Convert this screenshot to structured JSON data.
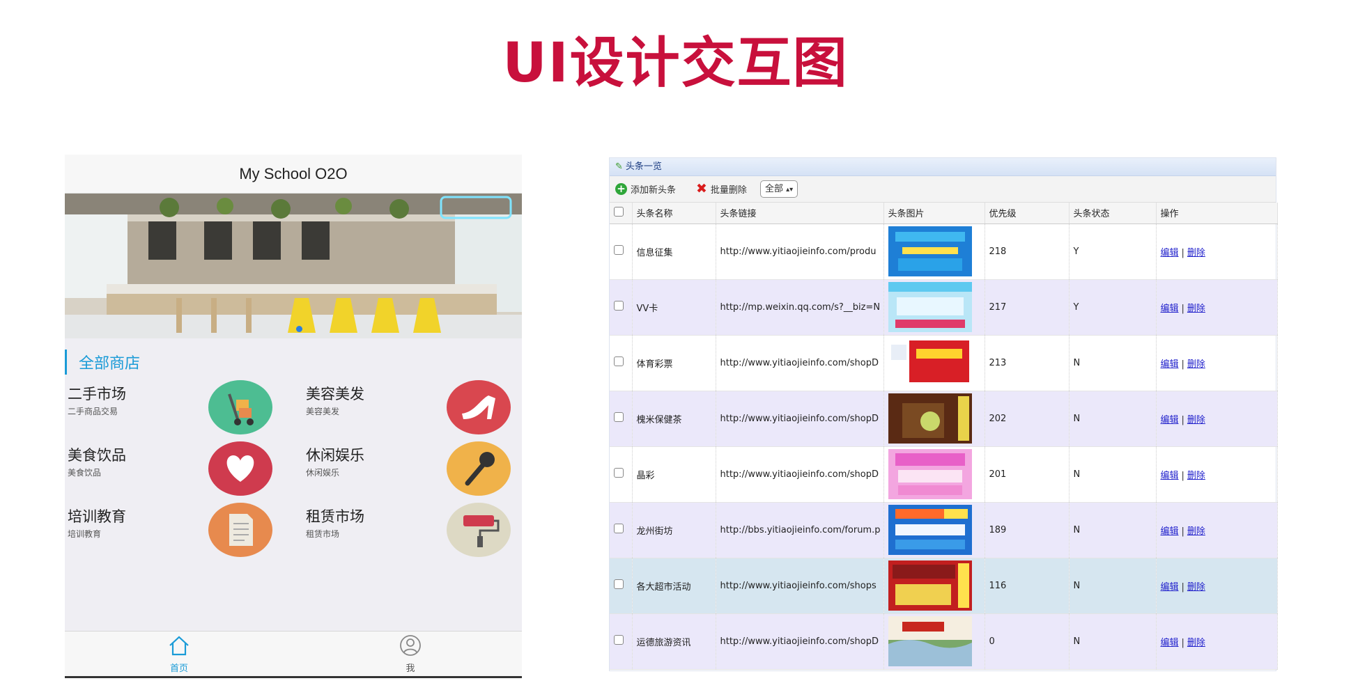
{
  "slide": {
    "title": "UI设计交互图"
  },
  "mobile": {
    "app_title": "My School O2O",
    "section_title": "全部商店",
    "categories": [
      {
        "name": "二手市场",
        "desc": "二手商品交易",
        "icon": "cart-icon",
        "color": "#4dbd92"
      },
      {
        "name": "美容美发",
        "desc": "美容美发",
        "icon": "high-heel-icon",
        "color": "#d9474f"
      },
      {
        "name": "美食饮品",
        "desc": "美食饮品",
        "icon": "heart-icon",
        "color": "#cf3b4e"
      },
      {
        "name": "休闲娱乐",
        "desc": "休闲娱乐",
        "icon": "microphone-icon",
        "color": "#f0b24a"
      },
      {
        "name": "培训教育",
        "desc": "培训教育",
        "icon": "document-icon",
        "color": "#e78a4e"
      },
      {
        "name": "租赁市场",
        "desc": "租赁市场",
        "icon": "paint-roller-icon",
        "color": "#ddd9c4"
      }
    ],
    "tabbar": [
      {
        "label": "首页",
        "icon": "home-icon",
        "active": true
      },
      {
        "label": "我",
        "icon": "user-icon",
        "active": false
      }
    ],
    "colors": {
      "accent": "#1a9bd7"
    }
  },
  "admin": {
    "panel_title": "头条一览",
    "toolbar": {
      "add_label": "添加新头条",
      "delete_label": "批量删除",
      "filter_value": "全部"
    },
    "columns": [
      "头条名称",
      "头条链接",
      "头条图片",
      "优先级",
      "头条状态",
      "操作"
    ],
    "rows": [
      {
        "name": "信息征集",
        "link": "http://www.yitiaojieinfo.com/produ",
        "priority": "218",
        "status": "Y",
        "edit": "编辑",
        "delete": "删除"
      },
      {
        "name": "VV卡",
        "link": "http://mp.weixin.qq.com/s?__biz=N",
        "priority": "217",
        "status": "Y",
        "edit": "编辑",
        "delete": "删除"
      },
      {
        "name": "体育彩票",
        "link": "http://www.yitiaojieinfo.com/shopD",
        "priority": "213",
        "status": "N",
        "edit": "编辑",
        "delete": "删除"
      },
      {
        "name": "槐米保健茶",
        "link": "http://www.yitiaojieinfo.com/shopD",
        "priority": "202",
        "status": "N",
        "edit": "编辑",
        "delete": "删除"
      },
      {
        "name": "晶彩",
        "link": "http://www.yitiaojieinfo.com/shopD",
        "priority": "201",
        "status": "N",
        "edit": "编辑",
        "delete": "删除"
      },
      {
        "name": "龙州街坊",
        "link": "http://bbs.yitiaojieinfo.com/forum.p",
        "priority": "189",
        "status": "N",
        "edit": "编辑",
        "delete": "删除"
      },
      {
        "name": "各大超市活动",
        "link": "http://www.yitiaojieinfo.com/shops",
        "priority": "116",
        "status": "N",
        "edit": "编辑",
        "delete": "删除"
      },
      {
        "name": "运德旅游资讯",
        "link": "http://www.yitiaojieinfo.com/shopD",
        "priority": "0",
        "status": "N",
        "edit": "编辑",
        "delete": "删除"
      }
    ],
    "colors": {
      "title_bar": "#d5e2f5",
      "alt_row": "#ebe8fa",
      "highlight_row": "#d6e6f0",
      "link": "#2222cc"
    }
  }
}
